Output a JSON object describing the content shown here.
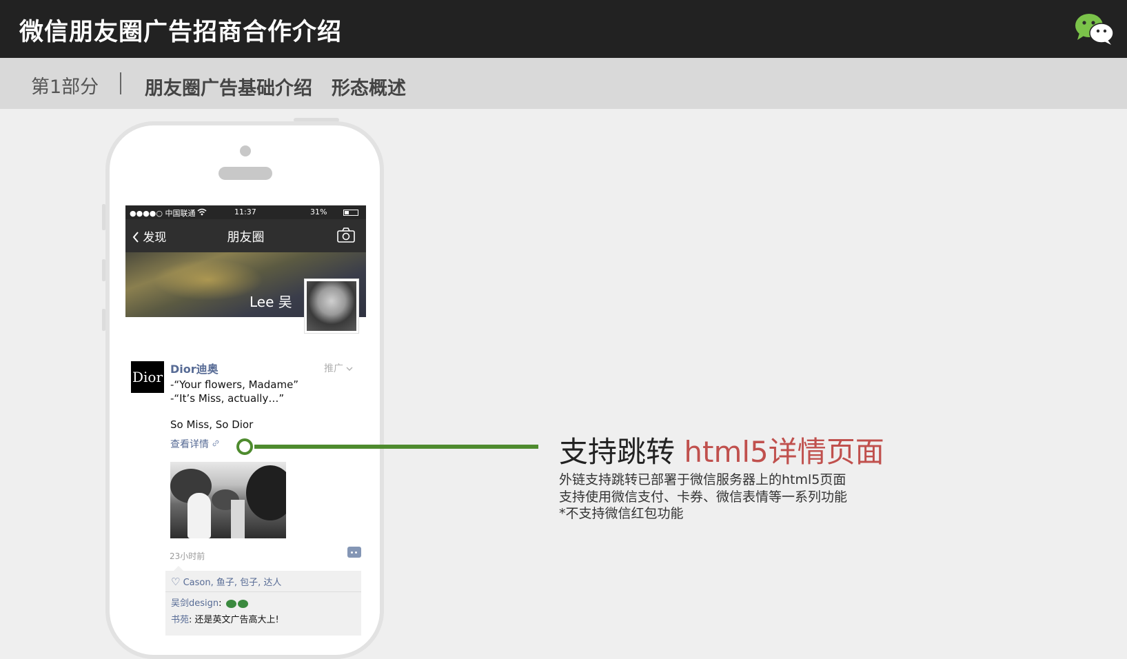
{
  "header": {
    "title": "微信朋友圈广告招商合作介绍"
  },
  "subheader": {
    "part": "第1部分",
    "section": "朋友圈广告基础介绍",
    "subsection": "形态概述"
  },
  "phone": {
    "status": {
      "carrier": "●●●●○ 中国联通",
      "time": "11:37",
      "battery": "31%"
    },
    "nav": {
      "back": "发现",
      "title": "朋友圈"
    },
    "profile": {
      "name": "Lee 吴"
    },
    "post": {
      "logo_text": "Dior",
      "brand": "Dior迪奥",
      "promo_label": "推广",
      "line1": "-“Your flowers, Madame”",
      "line2": "-“It’s Miss, actually…”",
      "slogan": "So Miss, So Dior",
      "link": "查看详情",
      "time_ago": "23小时前",
      "likes": "Cason, 鱼子, 包子, 达人",
      "comments": [
        {
          "name": "吴剑design",
          "text": ": "
        },
        {
          "name": "书苑",
          "text": ": 还是英文广告高大上!"
        }
      ]
    }
  },
  "feature": {
    "title_prefix": "支持跳转 ",
    "title_highlight": "html5详情页面",
    "lines": [
      "外链支持跳转已部署于微信服务器上的html5页面",
      "支持使用微信支付、卡券、微信表情等一系列功能",
      "*不支持微信红包功能"
    ]
  },
  "colors": {
    "header_bg": "#222222",
    "subheader_bg": "#d9d9d9",
    "accent_green": "#4e8b2e",
    "highlight_red": "#c0504d",
    "wechat_link": "#576b95"
  },
  "icons": [
    "wechat-logo-icon",
    "wifi-icon",
    "battery-icon",
    "back-chevron-icon",
    "camera-icon",
    "chevron-down-icon",
    "link-icon",
    "comment-icon",
    "heart-icon"
  ]
}
